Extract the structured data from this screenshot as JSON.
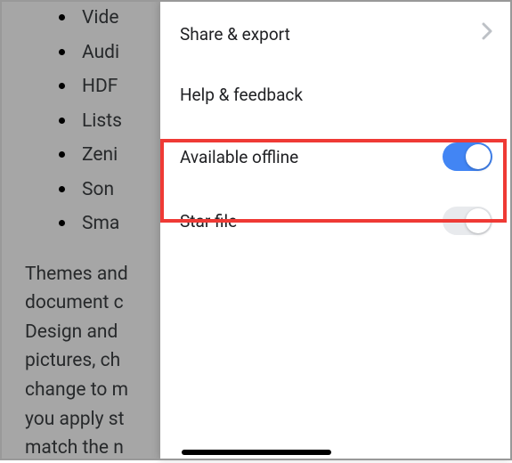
{
  "background": {
    "bullets": [
      "Vide",
      "Audi",
      "HDF",
      "Lists",
      "Zeni",
      "Son",
      "Sma"
    ],
    "paragraph": "Themes and\ndocument c\nDesign and\npictures, ch\nchange to m\nyou apply st\nmatch the n"
  },
  "menu": {
    "share_export": {
      "label": "Share & export"
    },
    "help_feedback": {
      "label": "Help & feedback"
    },
    "available_offline": {
      "label": "Available offline",
      "on": true
    },
    "star_file": {
      "label": "Star file",
      "on": false
    }
  },
  "colors": {
    "accent": "#4285f4",
    "highlight": "#ef3a35"
  }
}
